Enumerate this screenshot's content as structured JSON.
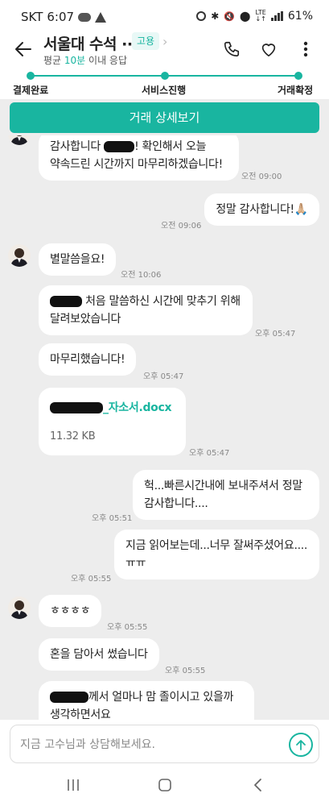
{
  "status_bar": {
    "carrier": "SKT",
    "time": "6:07",
    "battery": "61%"
  },
  "header": {
    "title": "서울대 수석 ··",
    "badge": "고용",
    "avg_prefix": "평균 ",
    "avg_value": "10분",
    "avg_suffix": " 이내 응답"
  },
  "progress": {
    "steps": [
      {
        "label": "결제완료"
      },
      {
        "label": "서비스진행"
      },
      {
        "label": "거래확정"
      }
    ]
  },
  "detail_button": "거래 상세보기",
  "messages": [
    {
      "from": "them",
      "lines": [
        "감사합니다 ",
        "! 확인해서 오늘",
        "약속드린 시간까지 마무리하겠습니다!"
      ],
      "time": "오전 09:00"
    },
    {
      "from": "me",
      "text": "정말 감사합니다!🙏🏼",
      "time": "오전 09:06"
    },
    {
      "from": "them",
      "text": "별말씀을요!",
      "time": "오전 10:06"
    },
    {
      "from": "them",
      "lines": [
        "처음 말씀하신 시간에 맞추기 위해",
        "달려보았습니다"
      ],
      "time": "오후 05:47"
    },
    {
      "from": "them",
      "text": "마무리했습니다!",
      "time": "오후 05:47"
    },
    {
      "from": "them",
      "file_name": "_자소서.docx",
      "file_size": "11.32 KB",
      "time": "오후 05:47"
    },
    {
      "from": "me",
      "lines": [
        "헉...빠른시간내에 보내주셔서 정말",
        "감사합니다...."
      ],
      "time": "오후 05:51"
    },
    {
      "from": "me",
      "lines": [
        "지금 읽어보는데...너무 잘써주셨어요....",
        "ㅠㅠ"
      ],
      "time": "오후 05:55"
    },
    {
      "from": "them",
      "text": "ㅎㅎㅎㅎ",
      "time": "오후 05:55"
    },
    {
      "from": "them",
      "text": "혼을 담아서 썼습니다",
      "time": "오후 05:55"
    },
    {
      "from": "them",
      "lines": [
        "께서 얼마나 맘 졸이시고 있을까",
        "생각하면서요"
      ]
    }
  ],
  "input": {
    "placeholder": "지금 고수님과 상담해보세요."
  },
  "colors": {
    "accent": "#19b5a0",
    "chat_bg": "#ededed",
    "bubble": "#ffffff"
  },
  "icons": [
    "back-arrow-icon",
    "phone-icon",
    "heart-icon",
    "more-vertical-icon",
    "send-icon",
    "recents-icon",
    "home-icon",
    "nav-back-icon"
  ]
}
